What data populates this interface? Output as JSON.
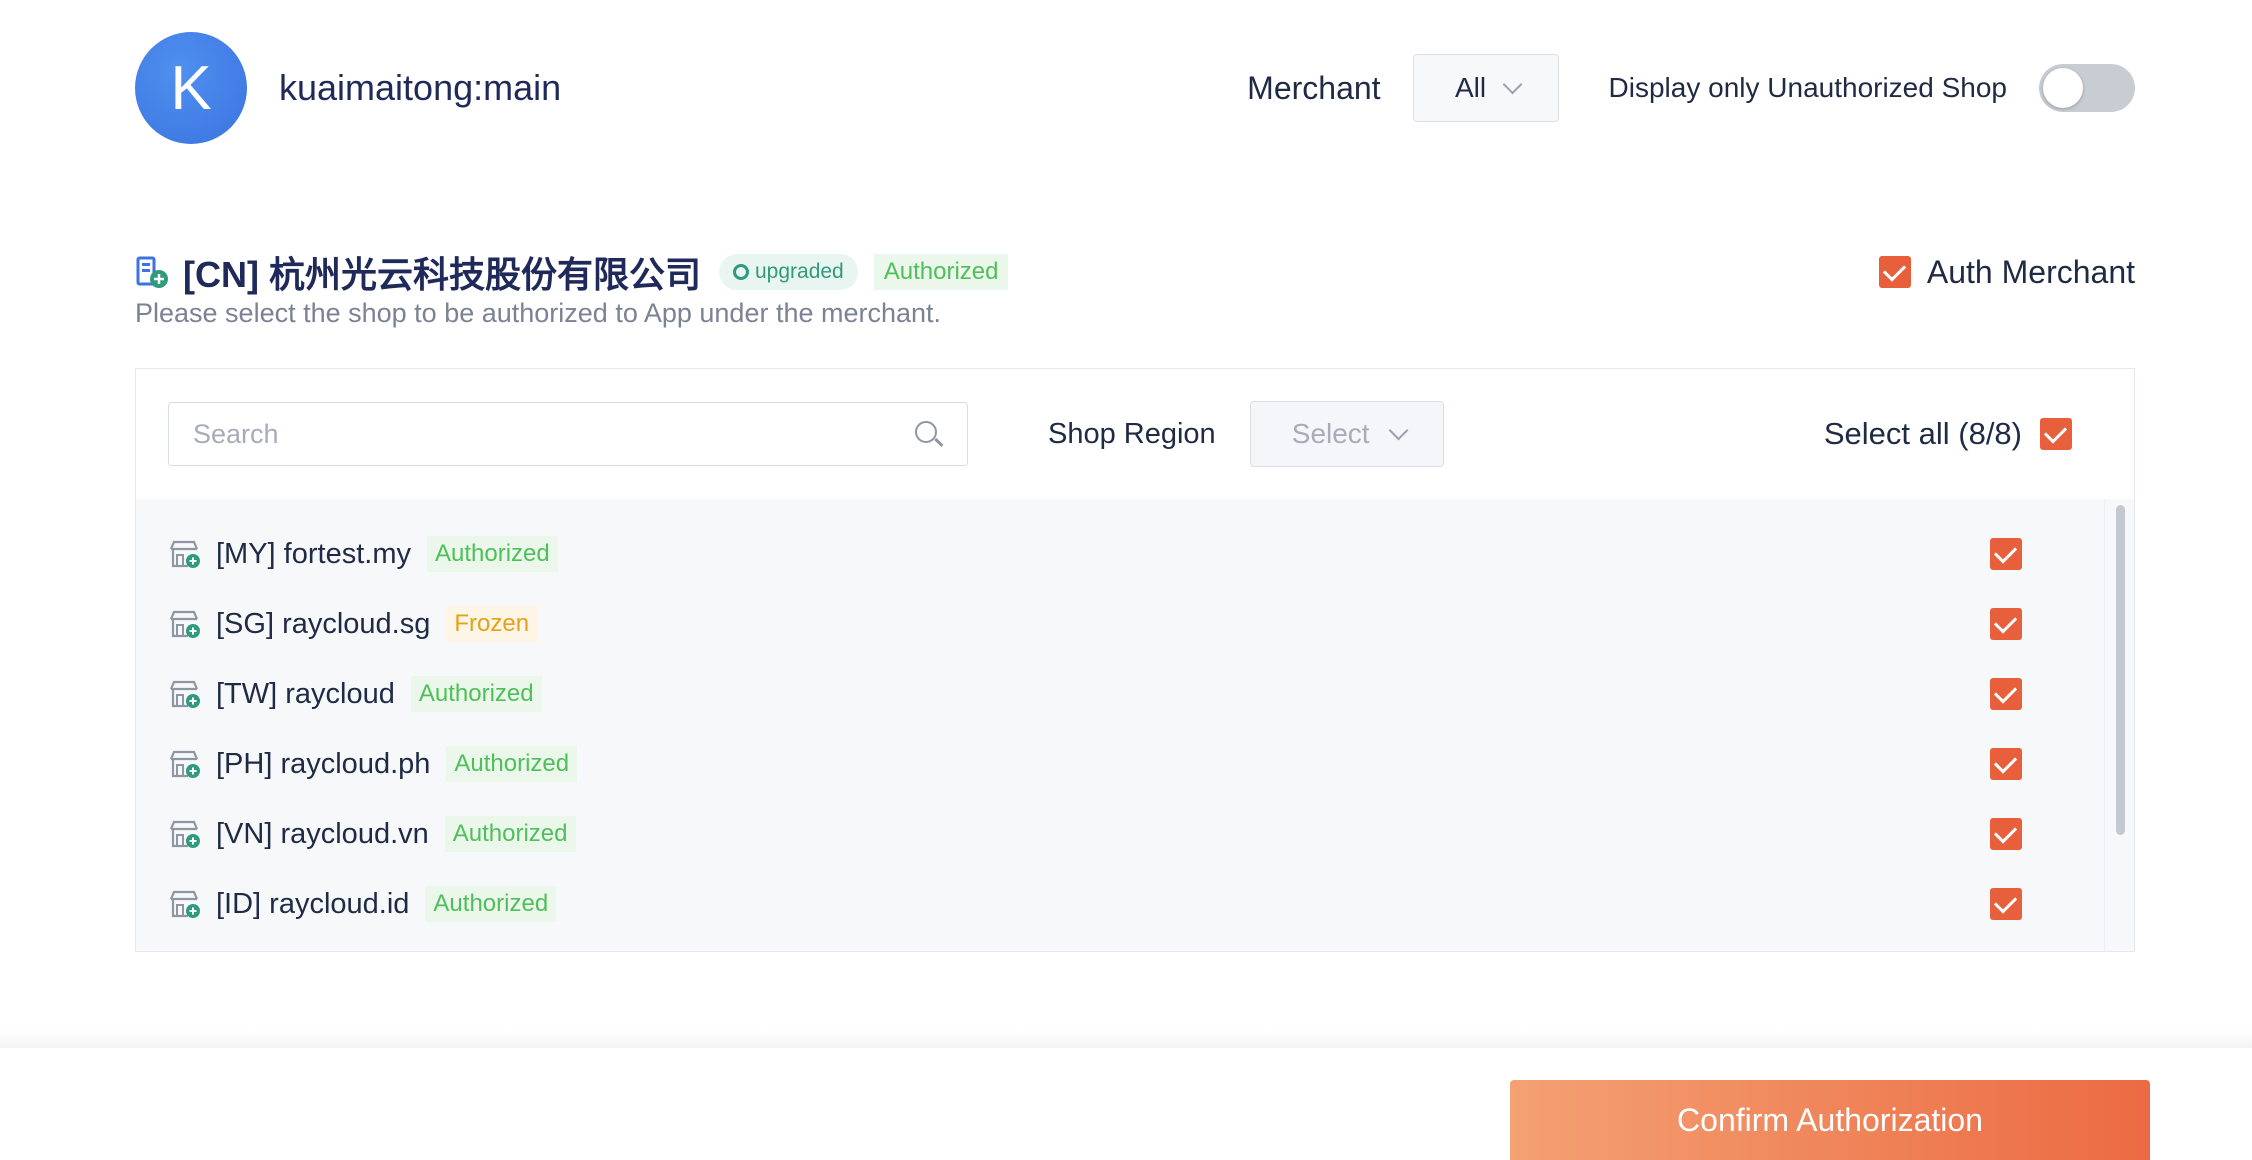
{
  "account": {
    "avatar_letter": "K",
    "name": "kuaimaitong:main"
  },
  "header": {
    "merchant_label": "Merchant",
    "merchant_value": "All",
    "toggle_label": "Display only Unauthorized Shop",
    "toggle_on": false
  },
  "merchant": {
    "title": "[CN]  杭州光云科技股份有限公司",
    "upgraded_badge": "upgraded",
    "status": "Authorized",
    "subtitle": "Please select the shop to be authorized to App under the merchant.",
    "auth_merchant_label": "Auth Merchant",
    "auth_merchant_checked": true
  },
  "filters": {
    "search_placeholder": "Search",
    "search_value": "",
    "region_label": "Shop Region",
    "region_placeholder": "Select",
    "select_all_label": "Select all (8/8)"
  },
  "shops": [
    {
      "name": "[MY] fortest.my",
      "status": "Authorized",
      "status_type": "authorized",
      "checked": true
    },
    {
      "name": "[SG] raycloud.sg",
      "status": "Frozen",
      "status_type": "frozen",
      "checked": true
    },
    {
      "name": "[TW] raycloud",
      "status": "Authorized",
      "status_type": "authorized",
      "checked": true
    },
    {
      "name": "[PH] raycloud.ph",
      "status": "Authorized",
      "status_type": "authorized",
      "checked": true
    },
    {
      "name": "[VN] raycloud.vn",
      "status": "Authorized",
      "status_type": "authorized",
      "checked": true
    },
    {
      "name": "[ID] raycloud.id",
      "status": "Authorized",
      "status_type": "authorized",
      "checked": true
    }
  ],
  "footer": {
    "confirm_label": "Confirm Authorization"
  },
  "colors": {
    "accent": "#e85f3c",
    "authorized": "#4fbf5a",
    "frozen": "#e4a11b",
    "avatar": "#3b73e0"
  }
}
